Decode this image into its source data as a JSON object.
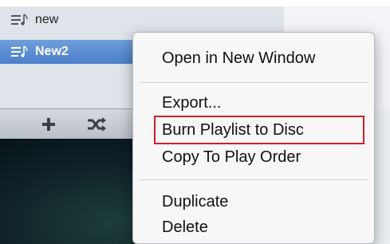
{
  "sidebar": {
    "items": [
      {
        "label": "new",
        "selected": false
      },
      {
        "label": "New2",
        "selected": true
      }
    ]
  },
  "toolbar": {
    "add_icon": "plus-icon",
    "shuffle_icon": "shuffle-icon"
  },
  "context_menu": {
    "groups": [
      [
        "Open in New Window"
      ],
      [
        "Export...",
        "Burn Playlist to Disc",
        "Copy To Play Order"
      ],
      [
        "Duplicate",
        "Delete"
      ]
    ],
    "highlighted": "Burn Playlist to Disc",
    "highlight_color": "#c8202a"
  }
}
